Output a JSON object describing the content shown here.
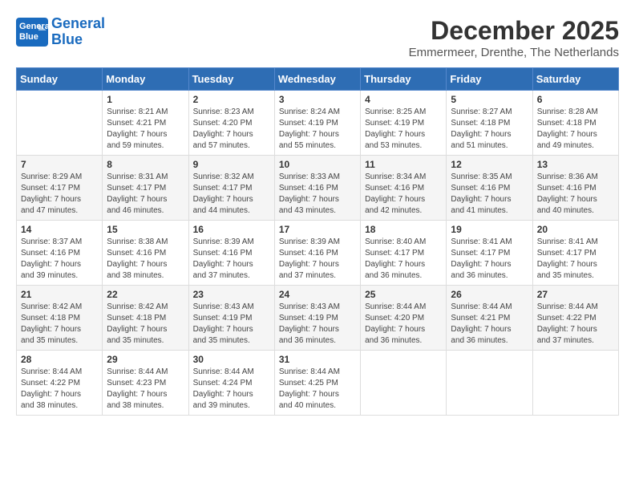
{
  "header": {
    "logo_line1": "General",
    "logo_line2": "Blue",
    "month": "December 2025",
    "location": "Emmermeer, Drenthe, The Netherlands"
  },
  "weekdays": [
    "Sunday",
    "Monday",
    "Tuesday",
    "Wednesday",
    "Thursday",
    "Friday",
    "Saturday"
  ],
  "weeks": [
    [
      {
        "day": "",
        "info": ""
      },
      {
        "day": "1",
        "info": "Sunrise: 8:21 AM\nSunset: 4:21 PM\nDaylight: 7 hours\nand 59 minutes."
      },
      {
        "day": "2",
        "info": "Sunrise: 8:23 AM\nSunset: 4:20 PM\nDaylight: 7 hours\nand 57 minutes."
      },
      {
        "day": "3",
        "info": "Sunrise: 8:24 AM\nSunset: 4:19 PM\nDaylight: 7 hours\nand 55 minutes."
      },
      {
        "day": "4",
        "info": "Sunrise: 8:25 AM\nSunset: 4:19 PM\nDaylight: 7 hours\nand 53 minutes."
      },
      {
        "day": "5",
        "info": "Sunrise: 8:27 AM\nSunset: 4:18 PM\nDaylight: 7 hours\nand 51 minutes."
      },
      {
        "day": "6",
        "info": "Sunrise: 8:28 AM\nSunset: 4:18 PM\nDaylight: 7 hours\nand 49 minutes."
      }
    ],
    [
      {
        "day": "7",
        "info": "Sunrise: 8:29 AM\nSunset: 4:17 PM\nDaylight: 7 hours\nand 47 minutes."
      },
      {
        "day": "8",
        "info": "Sunrise: 8:31 AM\nSunset: 4:17 PM\nDaylight: 7 hours\nand 46 minutes."
      },
      {
        "day": "9",
        "info": "Sunrise: 8:32 AM\nSunset: 4:17 PM\nDaylight: 7 hours\nand 44 minutes."
      },
      {
        "day": "10",
        "info": "Sunrise: 8:33 AM\nSunset: 4:16 PM\nDaylight: 7 hours\nand 43 minutes."
      },
      {
        "day": "11",
        "info": "Sunrise: 8:34 AM\nSunset: 4:16 PM\nDaylight: 7 hours\nand 42 minutes."
      },
      {
        "day": "12",
        "info": "Sunrise: 8:35 AM\nSunset: 4:16 PM\nDaylight: 7 hours\nand 41 minutes."
      },
      {
        "day": "13",
        "info": "Sunrise: 8:36 AM\nSunset: 4:16 PM\nDaylight: 7 hours\nand 40 minutes."
      }
    ],
    [
      {
        "day": "14",
        "info": "Sunrise: 8:37 AM\nSunset: 4:16 PM\nDaylight: 7 hours\nand 39 minutes."
      },
      {
        "day": "15",
        "info": "Sunrise: 8:38 AM\nSunset: 4:16 PM\nDaylight: 7 hours\nand 38 minutes."
      },
      {
        "day": "16",
        "info": "Sunrise: 8:39 AM\nSunset: 4:16 PM\nDaylight: 7 hours\nand 37 minutes."
      },
      {
        "day": "17",
        "info": "Sunrise: 8:39 AM\nSunset: 4:16 PM\nDaylight: 7 hours\nand 37 minutes."
      },
      {
        "day": "18",
        "info": "Sunrise: 8:40 AM\nSunset: 4:17 PM\nDaylight: 7 hours\nand 36 minutes."
      },
      {
        "day": "19",
        "info": "Sunrise: 8:41 AM\nSunset: 4:17 PM\nDaylight: 7 hours\nand 36 minutes."
      },
      {
        "day": "20",
        "info": "Sunrise: 8:41 AM\nSunset: 4:17 PM\nDaylight: 7 hours\nand 35 minutes."
      }
    ],
    [
      {
        "day": "21",
        "info": "Sunrise: 8:42 AM\nSunset: 4:18 PM\nDaylight: 7 hours\nand 35 minutes."
      },
      {
        "day": "22",
        "info": "Sunrise: 8:42 AM\nSunset: 4:18 PM\nDaylight: 7 hours\nand 35 minutes."
      },
      {
        "day": "23",
        "info": "Sunrise: 8:43 AM\nSunset: 4:19 PM\nDaylight: 7 hours\nand 35 minutes."
      },
      {
        "day": "24",
        "info": "Sunrise: 8:43 AM\nSunset: 4:19 PM\nDaylight: 7 hours\nand 36 minutes."
      },
      {
        "day": "25",
        "info": "Sunrise: 8:44 AM\nSunset: 4:20 PM\nDaylight: 7 hours\nand 36 minutes."
      },
      {
        "day": "26",
        "info": "Sunrise: 8:44 AM\nSunset: 4:21 PM\nDaylight: 7 hours\nand 36 minutes."
      },
      {
        "day": "27",
        "info": "Sunrise: 8:44 AM\nSunset: 4:22 PM\nDaylight: 7 hours\nand 37 minutes."
      }
    ],
    [
      {
        "day": "28",
        "info": "Sunrise: 8:44 AM\nSunset: 4:22 PM\nDaylight: 7 hours\nand 38 minutes."
      },
      {
        "day": "29",
        "info": "Sunrise: 8:44 AM\nSunset: 4:23 PM\nDaylight: 7 hours\nand 38 minutes."
      },
      {
        "day": "30",
        "info": "Sunrise: 8:44 AM\nSunset: 4:24 PM\nDaylight: 7 hours\nand 39 minutes."
      },
      {
        "day": "31",
        "info": "Sunrise: 8:44 AM\nSunset: 4:25 PM\nDaylight: 7 hours\nand 40 minutes."
      },
      {
        "day": "",
        "info": ""
      },
      {
        "day": "",
        "info": ""
      },
      {
        "day": "",
        "info": ""
      }
    ]
  ]
}
